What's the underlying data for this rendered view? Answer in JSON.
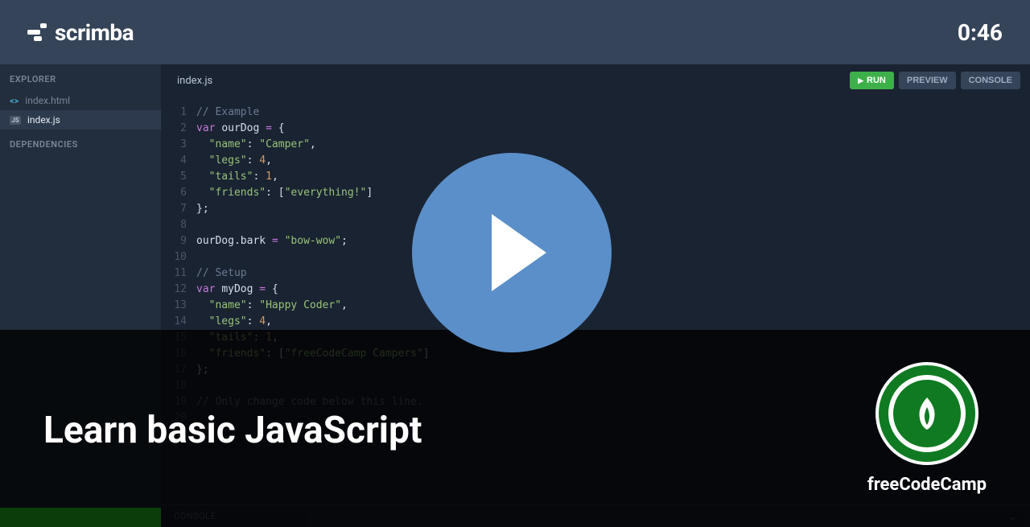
{
  "header": {
    "brand": "scrimba",
    "timestamp": "0:46"
  },
  "sidebar": {
    "explorer_label": "EXPLORER",
    "dependencies_label": "DEPENDENCIES",
    "files": [
      {
        "name": "index.html",
        "icon": "html",
        "active": false
      },
      {
        "name": "index.js",
        "icon": "js",
        "active": true
      }
    ]
  },
  "editor": {
    "active_tab": "index.js",
    "buttons": {
      "run": "RUN",
      "preview": "PREVIEW",
      "console": "CONSOLE"
    },
    "code_lines": [
      [
        [
          "comment",
          "// Example"
        ]
      ],
      [
        [
          "keyword",
          "var"
        ],
        [
          "plain",
          " "
        ],
        [
          "var",
          "ourDog"
        ],
        [
          "plain",
          " "
        ],
        [
          "op",
          "="
        ],
        [
          "plain",
          " "
        ],
        [
          "punct",
          "{"
        ]
      ],
      [
        [
          "plain",
          "  "
        ],
        [
          "string",
          "\"name\""
        ],
        [
          "punct",
          ":"
        ],
        [
          "plain",
          " "
        ],
        [
          "string",
          "\"Camper\""
        ],
        [
          "punct",
          ","
        ]
      ],
      [
        [
          "plain",
          "  "
        ],
        [
          "string",
          "\"legs\""
        ],
        [
          "punct",
          ":"
        ],
        [
          "plain",
          " "
        ],
        [
          "number",
          "4"
        ],
        [
          "punct",
          ","
        ]
      ],
      [
        [
          "plain",
          "  "
        ],
        [
          "string",
          "\"tails\""
        ],
        [
          "punct",
          ":"
        ],
        [
          "plain",
          " "
        ],
        [
          "number",
          "1"
        ],
        [
          "punct",
          ","
        ]
      ],
      [
        [
          "plain",
          "  "
        ],
        [
          "string",
          "\"friends\""
        ],
        [
          "punct",
          ":"
        ],
        [
          "plain",
          " "
        ],
        [
          "punct",
          "["
        ],
        [
          "string",
          "\"everything!\""
        ],
        [
          "punct",
          "]"
        ]
      ],
      [
        [
          "punct",
          "};"
        ]
      ],
      [
        [
          "plain",
          ""
        ]
      ],
      [
        [
          "var",
          "ourDog"
        ],
        [
          "punct",
          "."
        ],
        [
          "prop",
          "bark"
        ],
        [
          "plain",
          " "
        ],
        [
          "op",
          "="
        ],
        [
          "plain",
          " "
        ],
        [
          "string",
          "\"bow-wow\""
        ],
        [
          "punct",
          ";"
        ]
      ],
      [
        [
          "plain",
          ""
        ]
      ],
      [
        [
          "comment",
          "// Setup"
        ]
      ],
      [
        [
          "keyword",
          "var"
        ],
        [
          "plain",
          " "
        ],
        [
          "var",
          "myDog"
        ],
        [
          "plain",
          " "
        ],
        [
          "op",
          "="
        ],
        [
          "plain",
          " "
        ],
        [
          "punct",
          "{"
        ]
      ],
      [
        [
          "plain",
          "  "
        ],
        [
          "string",
          "\"name\""
        ],
        [
          "punct",
          ":"
        ],
        [
          "plain",
          " "
        ],
        [
          "string",
          "\"Happy Coder\""
        ],
        [
          "punct",
          ","
        ]
      ],
      [
        [
          "plain",
          "  "
        ],
        [
          "string",
          "\"legs\""
        ],
        [
          "punct",
          ":"
        ],
        [
          "plain",
          " "
        ],
        [
          "number",
          "4"
        ],
        [
          "punct",
          ","
        ]
      ],
      [
        [
          "plain",
          "  "
        ],
        [
          "string",
          "\"tails\""
        ],
        [
          "punct",
          ":"
        ],
        [
          "plain",
          " "
        ],
        [
          "number",
          "1"
        ],
        [
          "punct",
          ","
        ]
      ],
      [
        [
          "plain",
          "  "
        ],
        [
          "string",
          "\"friends\""
        ],
        [
          "punct",
          ":"
        ],
        [
          "plain",
          " "
        ],
        [
          "punct",
          "["
        ],
        [
          "string",
          "\"freeCodeCamp Campers\""
        ],
        [
          "punct",
          "]"
        ]
      ],
      [
        [
          "punct",
          "};"
        ]
      ],
      [
        [
          "plain",
          ""
        ]
      ],
      [
        [
          "comment",
          "// Only change code below this line."
        ]
      ],
      [
        [
          "plain",
          ""
        ]
      ]
    ]
  },
  "console": {
    "label": "CONSOLE"
  },
  "overlay": {
    "lesson_title": "Learn basic JavaScript",
    "author_name": "freeCodeCamp"
  }
}
